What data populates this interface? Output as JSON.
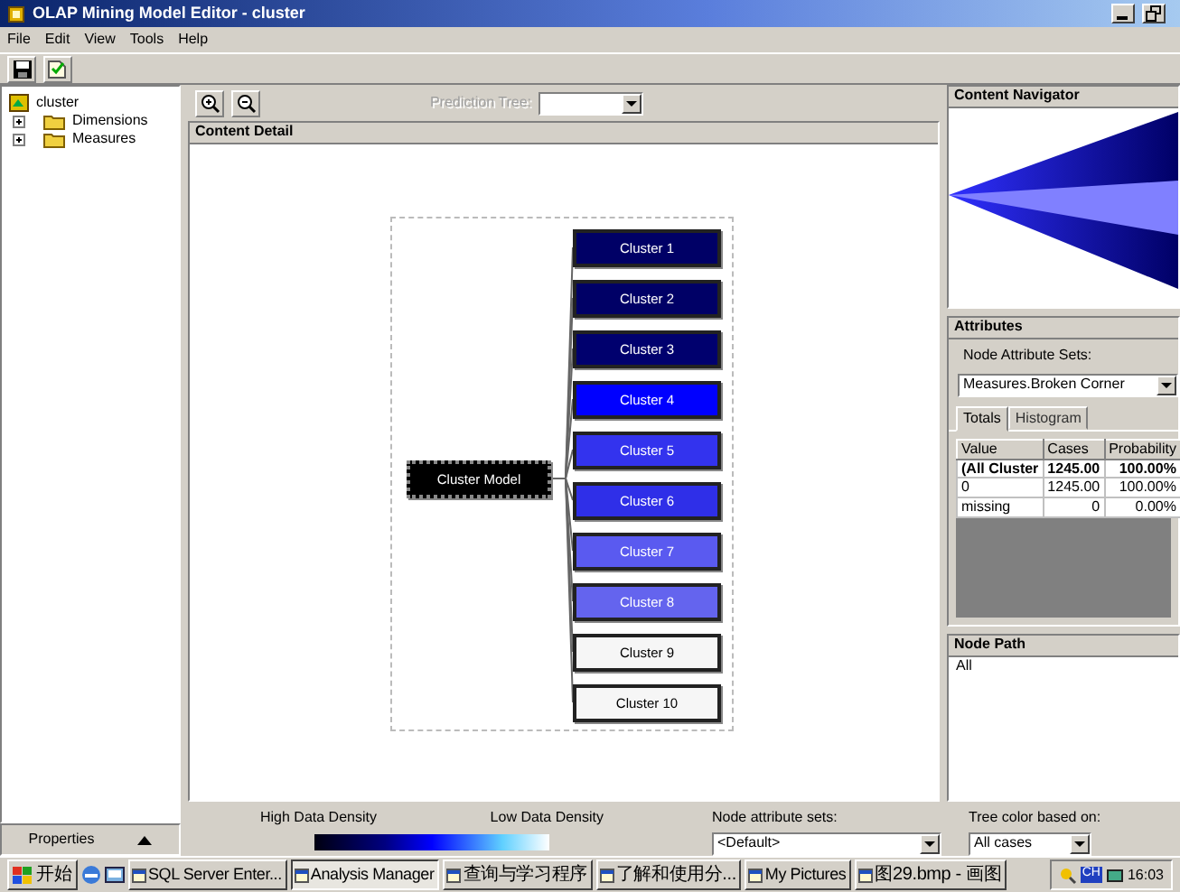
{
  "window": {
    "title": "OLAP Mining Model Editor - cluster"
  },
  "menu": [
    "File",
    "Edit",
    "View",
    "Tools",
    "Help"
  ],
  "tree": {
    "label": "cluster",
    "children": [
      {
        "label": "Dimensions",
        "expanded": false
      },
      {
        "label": "Measures",
        "expanded": false
      }
    ]
  },
  "properties_bar": {
    "label": "Properties"
  },
  "prediction_tree": {
    "label": "Prediction Tree:",
    "disabled": true
  },
  "content_detail": {
    "title": "Content Detail",
    "diagram": {
      "root": "Cluster Model",
      "nodes": [
        {
          "label": "Cluster 1",
          "color": "#000066"
        },
        {
          "label": "Cluster 2",
          "color": "#000066"
        },
        {
          "label": "Cluster 3",
          "color": "#00006e"
        },
        {
          "label": "Cluster 4",
          "color": "#0000ff"
        },
        {
          "label": "Cluster 5",
          "color": "#3333ee"
        },
        {
          "label": "Cluster 6",
          "color": "#2f2fe8"
        },
        {
          "label": "Cluster 7",
          "color": "#5a5af0"
        },
        {
          "label": "Cluster 8",
          "color": "#6464ee"
        },
        {
          "label": "Cluster 9",
          "color": "#f6f6f6"
        },
        {
          "label": "Cluster 10",
          "color": "#f6f6f6"
        }
      ]
    }
  },
  "content_navigator": {
    "title": "Content Navigator"
  },
  "attributes": {
    "title": "Attributes",
    "sets_label": "Node Attribute Sets:",
    "sets_value": "Measures.Broken Corner",
    "tabs": [
      {
        "label": "Totals",
        "selected": true
      },
      {
        "label": "Histogram",
        "selected": false
      }
    ],
    "columns": [
      "Value",
      "Cases",
      "Probability"
    ],
    "rows": [
      {
        "cells": [
          "(All Cluster",
          "1245.00",
          "100.00%"
        ],
        "emphasis": true
      },
      {
        "cells": [
          "0",
          "1245.00",
          "100.00%"
        ],
        "emphasis": false
      },
      {
        "cells": [
          "missing",
          "0",
          "0.00%"
        ],
        "emphasis": false
      }
    ]
  },
  "node_path": {
    "title": "Node Path",
    "value": "All"
  },
  "legend": {
    "high_label": "High Data Density",
    "low_label": "Low Data Density"
  },
  "node_attribute_sets": {
    "label": "Node attribute sets:",
    "value": "<Default>"
  },
  "tree_color": {
    "label": "Tree color based on:",
    "value": "All cases"
  },
  "taskbar": {
    "start": "开始",
    "tasks": [
      {
        "label": "SQL Server Enter...",
        "selected": false
      },
      {
        "label": "Analysis Manager",
        "selected": true
      },
      {
        "label": "查询与学习程序",
        "selected": false
      },
      {
        "label": "了解和使用分...",
        "selected": false
      },
      {
        "label": "My Pictures",
        "selected": false
      },
      {
        "label": "图29.bmp - 画图",
        "selected": false
      }
    ],
    "tray_lang": "CH",
    "clock": "16:03"
  }
}
